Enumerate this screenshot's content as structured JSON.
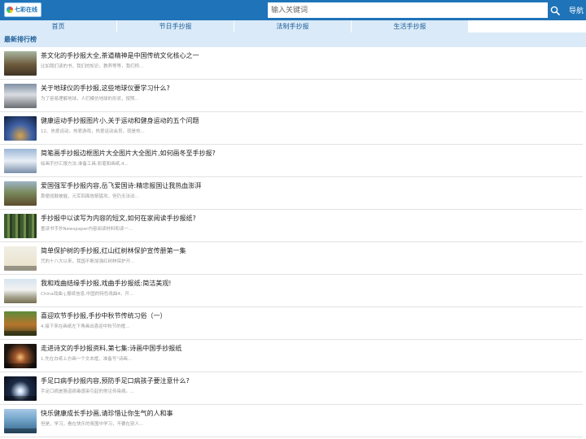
{
  "header": {
    "logo_text": "七彩在线",
    "search_placeholder": "输入关键词",
    "nav_label": "导航"
  },
  "nav": {
    "tabs": [
      {
        "label": "首页"
      },
      {
        "label": "节日手抄报"
      },
      {
        "label": "法制手抄报"
      },
      {
        "label": "生活手抄报"
      }
    ]
  },
  "section": {
    "title": "最新排行榜"
  },
  "list": {
    "items": [
      {
        "title": "茶文化的手抄报大全,茶道精神是中国传统文化核心之一",
        "desc": "比如我们读的书，我们的知识，教养等等，我们称..."
      },
      {
        "title": "关于地球仪的手抄报,这些地球仪要学习什么?",
        "desc": "为了容易理解地球，人们模仿地球的形状，按照..."
      },
      {
        "title": "健康运动手抄报图片小,关于运动和健身运动的五个问题",
        "desc": "12、热爱运动，热爱游戏，热爱运动会员，就是热..."
      },
      {
        "title": "简笔画手抄报边框图片大全图片大全图片,如何画冬至手抄报?",
        "desc": "绘画手抄汇报方法:准备工具:彩笔和画纸,4..."
      },
      {
        "title": "爱国强军手抄报内容,岳飞爱国诗:精忠报国让我热血澎湃",
        "desc": "那便战鼓被催，元军四面放箭猛攻，但仍无法动..."
      },
      {
        "title": "手抄报中以读写为内容的短文,如何在家阅读手抄报纸?",
        "desc": "童读书手抄Newspaper内容阅读材料和读一..."
      },
      {
        "title": "简单保护树的手抄报,红山红树林保护宣传册第一集",
        "desc": "咒的十八大以来，我国不断加强红树林保护开..."
      },
      {
        "title": "我和戏曲结缘手抄报,戏曲手抄报纸:简洁美观!",
        "desc": "China戏曲-j,报纸信息,中国的特色戏曲4。开..."
      },
      {
        "title": "喜迎欢节手抄报,手抄中秋节传统习俗（一）",
        "desc": "4.接下来在画纸左下角画出喜迎中秋节的框..."
      },
      {
        "title": "走进诗文的手抄报资料,第七集:诗画中国手抄报纸",
        "desc": "1.先在白纸上方画一个文本框，准备写\"诗画..."
      },
      {
        "title": "手足口病手抄报内容,预防手足口病孩子要注意什么?",
        "desc": "手足口病是肠道病毒感染引起的常见传染病。..."
      },
      {
        "title": "快乐健康成长手抄画,请珍惜让你生气的人和事",
        "desc": "但是，学习，看在快乐的氛围中学习，不要在别人..."
      }
    ]
  },
  "colors": {
    "header_bg": "#1f73b8",
    "nav_bg": "#daeaf8",
    "accent_text": "#1f5f99"
  }
}
